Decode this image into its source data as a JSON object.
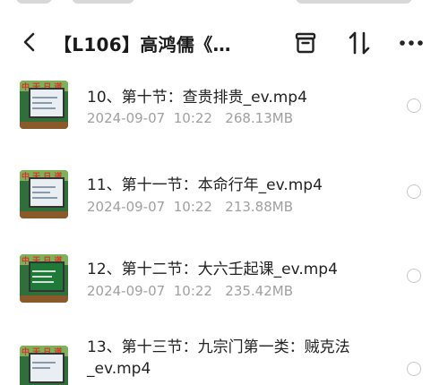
{
  "header": {
    "title": "【L106】高鸿儒《…",
    "icons": [
      "back-arrow-icon",
      "archive-box-icon",
      "sort-icon",
      "more-icon"
    ]
  },
  "files": [
    {
      "name": "10、第十节：查贵排贵_ev.mp4",
      "date": "2024-09-07",
      "time": "10:22",
      "size": "268.13MB"
    },
    {
      "name": "11、第十一节：本命行年_ev.mp4",
      "date": "2024-09-07",
      "time": "10:22",
      "size": "213.88MB"
    },
    {
      "name": "12、第十二节：大六壬起课_ev.mp4",
      "date": "2024-09-07",
      "time": "10:22",
      "size": "235.42MB"
    },
    {
      "name": "13、第十三节：九宗门第一类：贼克法_ev.mp4",
      "date": "",
      "time": "",
      "size": ""
    }
  ]
}
